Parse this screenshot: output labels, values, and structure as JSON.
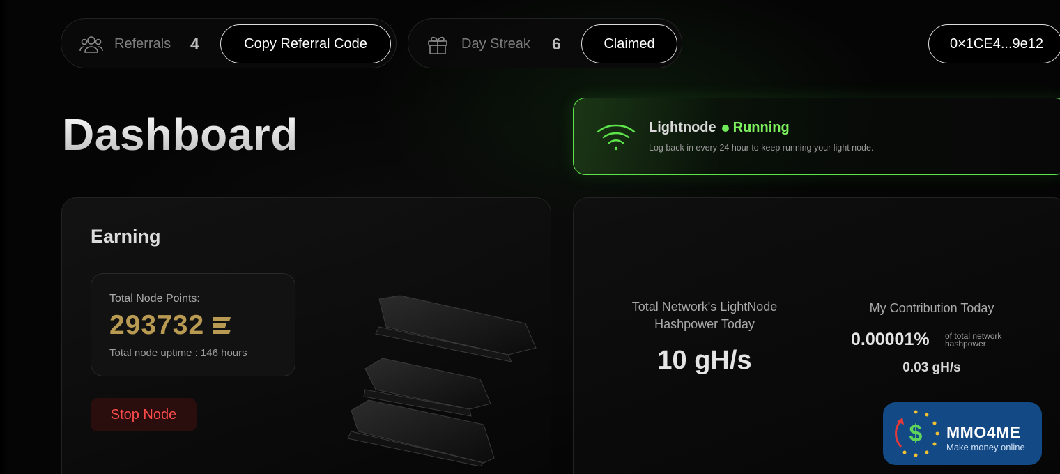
{
  "header": {
    "referrals": {
      "label": "Referrals",
      "count": "4",
      "button_label": "Copy Referral Code"
    },
    "streak": {
      "label": "Day Streak",
      "count": "6",
      "button_label": "Claimed"
    },
    "wallet": {
      "address": "0×1CE4...9e12"
    }
  },
  "page_title": "Dashboard",
  "node_status": {
    "name": "Lightnode",
    "status": "Running",
    "note": "Log back in every 24 hour to keep running your light node.",
    "status_color": "#7cf05f"
  },
  "earning": {
    "heading": "Earning",
    "points_label": "Total Node Points:",
    "points_value": "293732",
    "uptime": "Total node uptime : 146 hours",
    "stop_button": "Stop Node"
  },
  "network": {
    "hashpower_label": "Total Network's LightNode Hashpower Today",
    "hashpower_value": "10 gH/s",
    "contribution_label": "My Contribution Today",
    "contribution_percent": "0.00001%",
    "contribution_sub": "of total network hashpower",
    "contribution_rate": "0.03 gH/s"
  },
  "watermark": {
    "title": "MMO4ME",
    "subtitle": "Make money online",
    "color": "#134a86"
  }
}
